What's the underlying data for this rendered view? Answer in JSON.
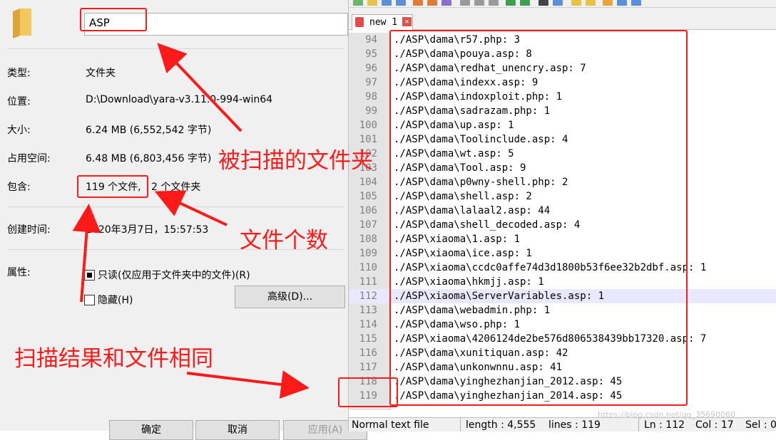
{
  "properties": {
    "name_value": "ASP",
    "rows": [
      {
        "label": "类型:",
        "value": "文件夹"
      },
      {
        "label": "位置:",
        "value": "D:\\Download\\yara-v3.11.0-994-win64"
      },
      {
        "label": "大小:",
        "value": "6.24 MB (6,552,542 字节)"
      },
      {
        "label": "占用空间:",
        "value": "6.48 MB (6,803,456 字节)"
      },
      {
        "label": "包含:",
        "value_files": "119 个文件,",
        "value_folders": "2 个文件夹"
      },
      {
        "label": "创建时间:",
        "value": "2020年3月7日，15:57:53"
      },
      {
        "label": "属性:"
      }
    ],
    "readonly_label": "只读(仅应用于文件夹中的文件)(R)",
    "readonly_checked": true,
    "hidden_label": "隐藏(H)",
    "hidden_checked": false,
    "advanced_button": "高级(D)...",
    "ok_button": "确定",
    "cancel_button": "取消",
    "apply_button": "应用(A)"
  },
  "editor": {
    "tab_label": "new 1",
    "lines": [
      {
        "n": "94",
        "text": "./ASP\\dama\\r57.php: 3"
      },
      {
        "n": "95",
        "text": "./ASP\\dama\\pouya.asp: 8"
      },
      {
        "n": "96",
        "text": "./ASP\\dama\\redhat_unencry.asp: 7"
      },
      {
        "n": "97",
        "text": "./ASP\\dama\\indexx.asp: 9"
      },
      {
        "n": "98",
        "text": "./ASP\\dama\\indoxploit.php: 1"
      },
      {
        "n": "99",
        "text": "./ASP\\dama\\sadrazam.php: 1"
      },
      {
        "n": "100",
        "text": "./ASP\\dama\\up.asp: 1"
      },
      {
        "n": "101",
        "text": "./ASP\\dama\\Toolinclude.asp: 4"
      },
      {
        "n": "102",
        "text": "./ASP\\dama\\wt.asp: 5"
      },
      {
        "n": "103",
        "text": "./ASP\\dama\\Tool.asp: 9"
      },
      {
        "n": "104",
        "text": "./ASP\\dama\\p0wny-shell.php: 2"
      },
      {
        "n": "105",
        "text": "./ASP\\dama\\shell.asp: 2"
      },
      {
        "n": "106",
        "text": "./ASP\\dama\\lalaal2.asp: 44"
      },
      {
        "n": "107",
        "text": "./ASP\\dama\\shell_decoded.asp: 4"
      },
      {
        "n": "108",
        "text": "./ASP\\xiaoma\\1.asp: 1"
      },
      {
        "n": "109",
        "text": "./ASP\\xiaoma\\ice.asp: 1"
      },
      {
        "n": "110",
        "text": "./ASP\\xiaoma\\ccdc0affe74d3d1800b53f6ee32b2dbf.asp: 1"
      },
      {
        "n": "111",
        "text": "./ASP\\xiaoma\\hkmjj.asp: 1"
      },
      {
        "n": "112",
        "text": "./ASP\\xiaoma\\ServerVariables.asp: 1"
      },
      {
        "n": "113",
        "text": "./ASP\\dama\\webadmin.php: 1"
      },
      {
        "n": "114",
        "text": "./ASP\\dama\\wso.php: 1"
      },
      {
        "n": "115",
        "text": "./ASP\\xiaoma\\4206124de2be576d806538439bb17320.asp: 7"
      },
      {
        "n": "116",
        "text": "./ASP\\dama\\xunitiquan.asp: 42"
      },
      {
        "n": "117",
        "text": "./ASP\\dama\\unkonwnnu.asp: 41"
      },
      {
        "n": "118",
        "text": "./ASP\\dama\\yinghezhanjian_2012.asp: 45"
      },
      {
        "n": "119",
        "text": "./ASP\\dama\\yinghezhanjian_2014.asp: 45"
      }
    ],
    "current_line": "112",
    "status": {
      "type": "Normal text file",
      "length": "length : 4,555",
      "lines": "lines : 119",
      "ln": "Ln : 112",
      "col": "Col : 17",
      "sel": "Sel : 0"
    }
  },
  "annotations": {
    "scanned_folder": "被扫描的文件夹",
    "file_count": "文件个数",
    "same_result": "扫描结果和文件相同",
    "color": "#ff1a1a"
  },
  "watermark": "https://blog.csdn.net/qq_35690060"
}
